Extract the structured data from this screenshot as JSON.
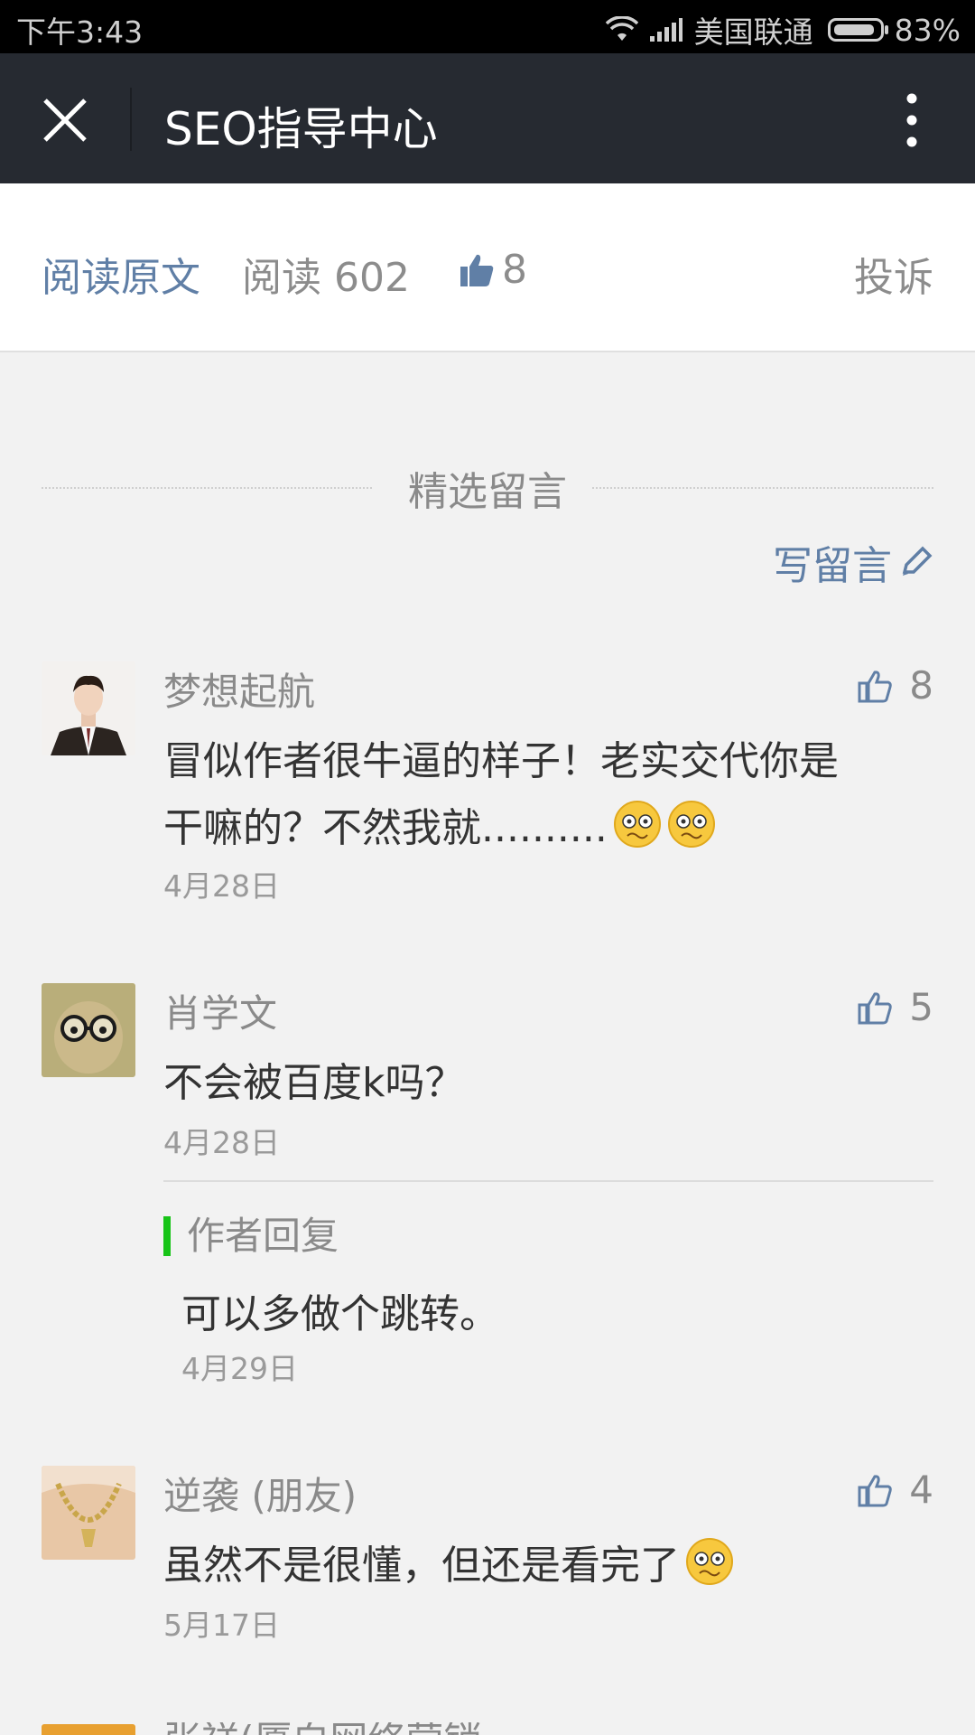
{
  "status_bar": {
    "time": "下午3:43",
    "carrier": "美国联通",
    "battery": "83%",
    "icons": [
      "wifi-icon",
      "signal-icon",
      "battery-icon"
    ]
  },
  "top_bar": {
    "title": "SEO指导中心",
    "close_icon": "close-icon",
    "more_icon": "more-vertical-icon"
  },
  "article_bar": {
    "read_original": "阅读原文",
    "read_count": "阅读 602",
    "likes": "8",
    "report": "投诉"
  },
  "section": {
    "title": "精选留言",
    "write_label": "写留言"
  },
  "comments": [
    {
      "name": "梦想起航",
      "likes": "8",
      "text_line1": "冒似作者很牛逼的样子！老实交代你是",
      "text_line2": "干嘛的？不然我就..........",
      "date": "4月28日"
    },
    {
      "name": "肖学文",
      "likes": "5",
      "text_line1": "不会被百度k吗？",
      "date": "4月28日",
      "reply": {
        "label": "作者回复",
        "text": "可以多做个跳转。",
        "date": "4月29日"
      }
    },
    {
      "name": "逆袭 (朋友)",
      "likes": "4",
      "text_line1": "虽然不是很懂，但还是看完了",
      "date": "5月17日"
    },
    {
      "name": "张祥(厦白网络营销"
    }
  ],
  "colors": {
    "link_blue": "#607fa6",
    "reply_bar_green": "#18c418",
    "top_bar_bg": "#262a31"
  }
}
